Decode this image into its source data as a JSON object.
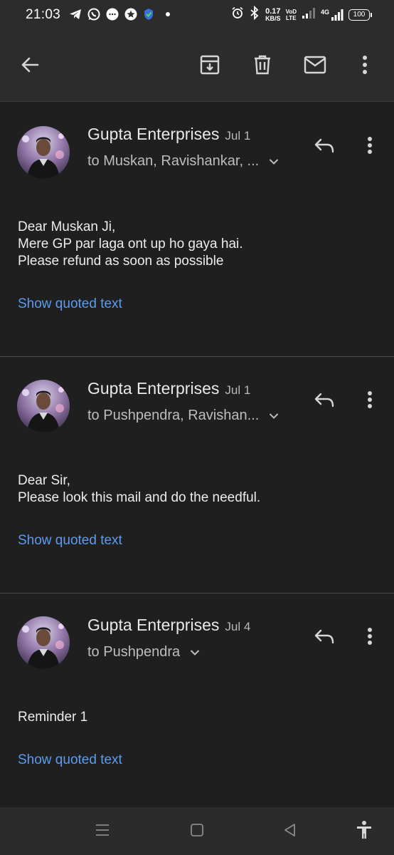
{
  "status_bar": {
    "time": "21:03",
    "speed_value": "0.17",
    "speed_unit": "KB/S",
    "volte_top": "VoD",
    "volte_bottom": "LTE",
    "network_type": "4G",
    "battery": "100",
    "icons": [
      "telegram-icon",
      "whatsapp-icon",
      "chat-bubble-icon",
      "star-icon",
      "vpn-shield-icon",
      "dot-icon",
      "alarm-icon",
      "bluetooth-icon",
      "signal-icon"
    ]
  },
  "app_bar": {
    "icons": [
      "back-arrow-icon",
      "archive-icon",
      "delete-icon",
      "mark-unread-icon",
      "more-vert-icon"
    ]
  },
  "colors": {
    "background": "#1f1f1f",
    "bar_background": "#2c2c2c",
    "link": "#5b9cf2"
  },
  "messages": [
    {
      "sender": "Gupta Enterprises",
      "date": "Jul 1",
      "recipients": "to Muskan, Ravishankar, ...",
      "body": [
        "Dear Muskan Ji,",
        "Mere GP par laga ont up ho gaya hai.",
        "Please refund as soon as possible"
      ],
      "show_quoted": "Show quoted text"
    },
    {
      "sender": "Gupta Enterprises",
      "date": "Jul 1",
      "recipients": "to Pushpendra, Ravishan...",
      "body": [
        "Dear Sir,",
        "Please look this mail and do the needful."
      ],
      "show_quoted": "Show quoted text"
    },
    {
      "sender": "Gupta Enterprises",
      "date": "Jul 4",
      "recipients": "to Pushpendra",
      "body": [
        "Reminder 1"
      ],
      "show_quoted": "Show quoted text"
    }
  ],
  "nav_bar": {
    "icons": [
      "menu-icon",
      "home-square-icon",
      "back-triangle-icon",
      "accessibility-icon"
    ]
  }
}
